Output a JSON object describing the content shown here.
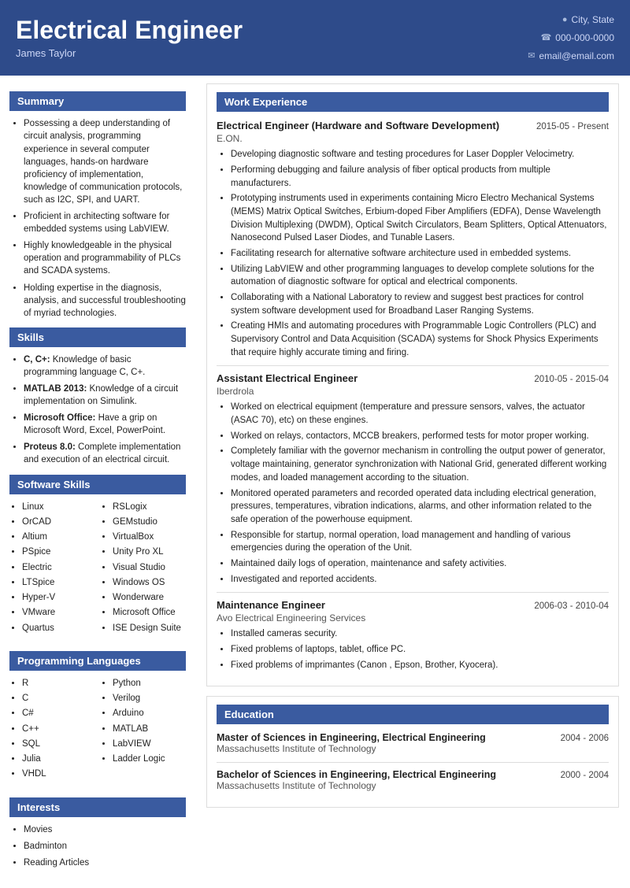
{
  "header": {
    "title": "Electrical Engineer",
    "name": "James Taylor",
    "city": "City, State",
    "phone": "000-000-0000",
    "email": "email@email.com"
  },
  "sidebar": {
    "summary_title": "Summary",
    "summary_bullets": [
      "Possessing a deep understanding of circuit analysis, programming experience in several computer languages, hands-on hardware proficiency of implementation, knowledge of communication protocols, such as I2C, SPI, and UART.",
      "Proficient in architecting software for embedded systems using LabVIEW.",
      "Highly knowledgeable in the physical operation and programmability of PLCs and SCADA systems.",
      "Holding expertise in the diagnosis, analysis, and successful troubleshooting of myriad technologies."
    ],
    "skills_title": "Skills",
    "skills": [
      {
        "bold": "C, C+:",
        "text": " Knowledge of basic programming language C, C+."
      },
      {
        "bold": "MATLAB 2013:",
        "text": " Knowledge of a circuit implementation on Simulink."
      },
      {
        "bold": "Microsoft Office:",
        "text": " Have a grip on Microsoft Word, Excel, PowerPoint."
      },
      {
        "bold": "Proteus 8.0:",
        "text": " Complete implementation and execution of an electrical circuit."
      }
    ],
    "software_title": "Software Skills",
    "software_col1": [
      "Linux",
      "OrCAD",
      "Altium",
      "PSpice",
      "Electric",
      "LTSpice",
      "Hyper-V",
      "VMware",
      "Quartus"
    ],
    "software_col2": [
      "RSLogix",
      "GEMstudio",
      "VirtualBox",
      "Unity Pro XL",
      "Visual Studio",
      "Windows OS",
      "Wonderware",
      "Microsoft Office",
      "ISE Design Suite"
    ],
    "prog_title": "Programming Languages",
    "prog_col1": [
      "R",
      "C",
      "C#",
      "C++",
      "SQL",
      "Julia",
      "VHDL"
    ],
    "prog_col2": [
      "Python",
      "Verilog",
      "Arduino",
      "MATLAB",
      "LabVIEW",
      "Ladder Logic"
    ],
    "interests_title": "Interests",
    "interests": [
      "Movies",
      "Badminton",
      "Reading Articles"
    ]
  },
  "work": {
    "section_title": "Work Experience",
    "jobs": [
      {
        "title": "Electrical Engineer (Hardware and Software Development)",
        "dates": "2015-05 - Present",
        "company": "E.ON.",
        "bullets": [
          "Developing diagnostic software and testing procedures for Laser Doppler Velocimetry.",
          "Performing debugging and failure analysis of fiber optical products from multiple manufacturers.",
          "Prototyping instruments used in experiments containing Micro Electro Mechanical Systems (MEMS) Matrix Optical Switches, Erbium-doped Fiber Amplifiers (EDFA), Dense Wavelength Division Multiplexing (DWDM), Optical Switch Circulators, Beam Splitters, Optical Attenuators, Nanosecond Pulsed Laser Diodes, and Tunable Lasers.",
          "Facilitating research for alternative software architecture used in embedded systems.",
          "Utilizing LabVIEW and other programming languages to develop complete solutions for the automation of diagnostic software for optical and electrical components.",
          "Collaborating with a National Laboratory to review and suggest best practices for control system software development used for Broadband Laser Ranging Systems.",
          "Creating HMIs and automating procedures with Programmable Logic Controllers (PLC) and Supervisory Control and Data Acquisition (SCADA) systems for Shock Physics Experiments that require highly accurate timing and firing."
        ]
      },
      {
        "title": "Assistant Electrical Engineer",
        "dates": "2010-05 - 2015-04",
        "company": "Iberdrola",
        "bullets": [
          "Worked on electrical equipment (temperature and pressure sensors, valves, the actuator (ASAC 70), etc) on these engines.",
          "Worked on relays, contactors, MCCB breakers, performed tests for motor proper working.",
          "Completely familiar with the governor mechanism in controlling the output power of generator, voltage maintaining, generator synchronization with National Grid, generated different working modes, and loaded management according to the situation.",
          "Monitored operated parameters and recorded operated data including electrical generation, pressures, temperatures, vibration indications, alarms, and other information related to the safe operation of the powerhouse equipment.",
          "Responsible for startup, normal operation, load management and handling of various emergencies during the operation of the Unit.",
          "Maintained daily logs of operation, maintenance and safety activities.",
          "Investigated and reported accidents."
        ]
      },
      {
        "title": "Maintenance Engineer",
        "dates": "2006-03 - 2010-04",
        "company": "Avo Electrical Engineering Services",
        "bullets": [
          "Installed cameras security.",
          "Fixed problems of laptops, tablet, office PC.",
          "Fixed problems of imprimantes (Canon , Epson, Brother, Kyocera)."
        ]
      }
    ]
  },
  "education": {
    "section_title": "Education",
    "degrees": [
      {
        "degree": "Master of Sciences in Engineering, Electrical Engineering",
        "dates": "2004 - 2006",
        "school": "Massachusetts Institute of Technology"
      },
      {
        "degree": "Bachelor of Sciences in Engineering, Electrical Engineering",
        "dates": "2000 - 2004",
        "school": "Massachusetts Institute of Technology"
      }
    ]
  }
}
